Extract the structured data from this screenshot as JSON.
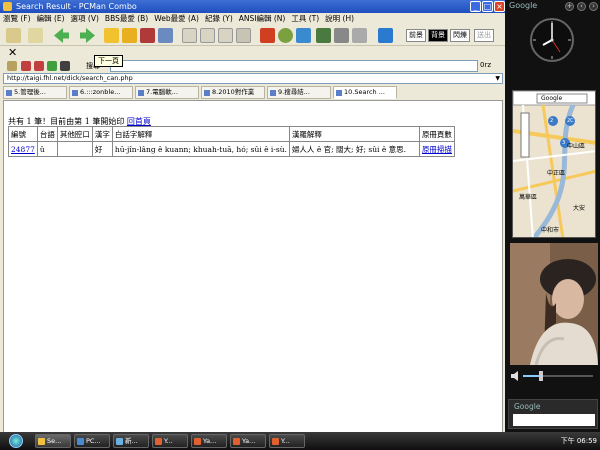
{
  "window": {
    "title": "Search Result - PCMan Combo"
  },
  "menu": [
    {
      "label": "瀏覽 (F)"
    },
    {
      "label": "編輯 (E)"
    },
    {
      "label": "選項 (V)"
    },
    {
      "label": "BBS最愛 (B)"
    },
    {
      "label": "Web最愛 (A)"
    },
    {
      "label": "紀錄 (Y)"
    },
    {
      "label": "ANSI編輯 (N)"
    },
    {
      "label": "工具 (T)"
    },
    {
      "label": "說明 (H)"
    }
  ],
  "toolbar": {
    "btn_1": "前景",
    "btn_2": "背景",
    "btn_3": "閃爍",
    "btn_4": "送出"
  },
  "tooltip": "下一頁",
  "search": {
    "label": "搜尋",
    "option": "0rz"
  },
  "address": {
    "url": "http://taigi.fhl.net/dick/search_can.php"
  },
  "tabs": [
    {
      "label": "5.管理後..."
    },
    {
      "label": "6.:::zonble..."
    },
    {
      "label": "7.電腦軟..."
    },
    {
      "label": "8.2010對作業"
    },
    {
      "label": "9.搜尋結..."
    },
    {
      "label": "10.Search ..."
    }
  ],
  "result": {
    "summary": "共有 1 筆！目前由第 1 筆開始印",
    "home_link": "回首頁"
  },
  "table": {
    "headers": [
      "編號",
      "台語",
      "其他腔口",
      "漢字",
      "白話字解釋",
      "漢羅解釋",
      "原冊頁數"
    ],
    "rows": [
      [
        "24877",
        "ǔ",
        "",
        "好",
        "hū-jîn-lâng ê kuann; khuah-tuā, hó; sûi ê i-sù.",
        "婦人人 ê 官; 闊大; 好; sûi ê 意思.",
        "原冊掃描"
      ]
    ]
  },
  "sidebar": {
    "gadget_title": "Google",
    "map_search": "Google",
    "gsearch_label": "Google"
  },
  "map": {
    "labels": [
      "中山區",
      "中正區",
      "萬華區",
      "大安",
      "中和市",
      "2",
      "2C",
      "3"
    ]
  },
  "taskbar": {
    "tasks": [
      {
        "label": "Se..."
      },
      {
        "label": "PC..."
      },
      {
        "label": "新..."
      },
      {
        "label": "Y..."
      },
      {
        "label": "Ya..."
      },
      {
        "label": "Ya..."
      },
      {
        "label": "Y..."
      }
    ],
    "clock": "下午 06:59"
  },
  "colors": {
    "accent": "#1f4fbf",
    "link": "#0000cc",
    "sidebar": "#111111"
  }
}
